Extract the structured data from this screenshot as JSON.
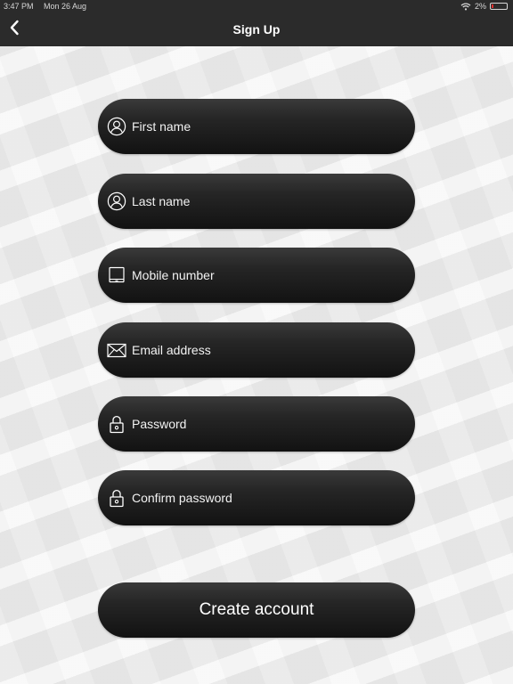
{
  "status_bar": {
    "time": "3:47 PM",
    "date": "Mon 26 Aug",
    "battery": "2%",
    "battery_color": "#e03030"
  },
  "nav": {
    "title": "Sign Up",
    "back_icon": "chevron-left-icon"
  },
  "form": {
    "fields": [
      {
        "placeholder": "First name",
        "icon": "user-icon"
      },
      {
        "placeholder": "Last name",
        "icon": "user-icon"
      },
      {
        "placeholder": "Mobile number",
        "icon": "tablet-icon"
      },
      {
        "placeholder": "Email address",
        "icon": "envelope-icon"
      },
      {
        "placeholder": "Password",
        "icon": "lock-icon"
      },
      {
        "placeholder": "Confirm password",
        "icon": "lock-icon"
      }
    ],
    "submit_label": "Create account"
  },
  "colors": {
    "bar_background": "#2b2b2b",
    "field_background": "#1c1c1c",
    "text": "#ffffff"
  }
}
